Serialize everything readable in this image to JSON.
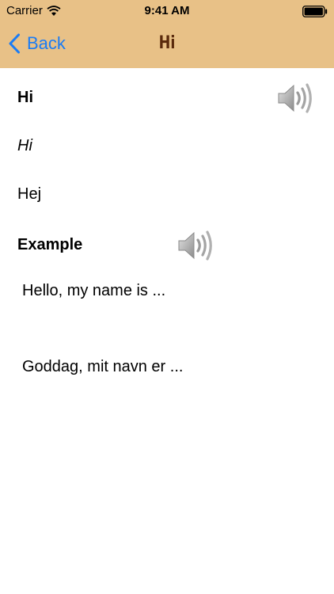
{
  "status_bar": {
    "carrier": "Carrier",
    "time": "9:41 AM",
    "wifi_icon": "wifi-icon",
    "battery_icon": "battery-full-icon"
  },
  "nav": {
    "back_label": "Back",
    "back_icon": "chevron-left-icon",
    "title": "Hi",
    "bar_color": "#e8c187",
    "title_color": "#5a2a0c",
    "back_color": "#1a7cf5"
  },
  "entry": {
    "word": "Hi",
    "phonetic": "Hi",
    "translation": "Hej",
    "word_audio_icon": "speaker-icon"
  },
  "example": {
    "heading": "Example",
    "audio_icon": "speaker-icon",
    "sentence": "Hello, my name is ...",
    "translation": "Goddag, mit navn er ..."
  }
}
